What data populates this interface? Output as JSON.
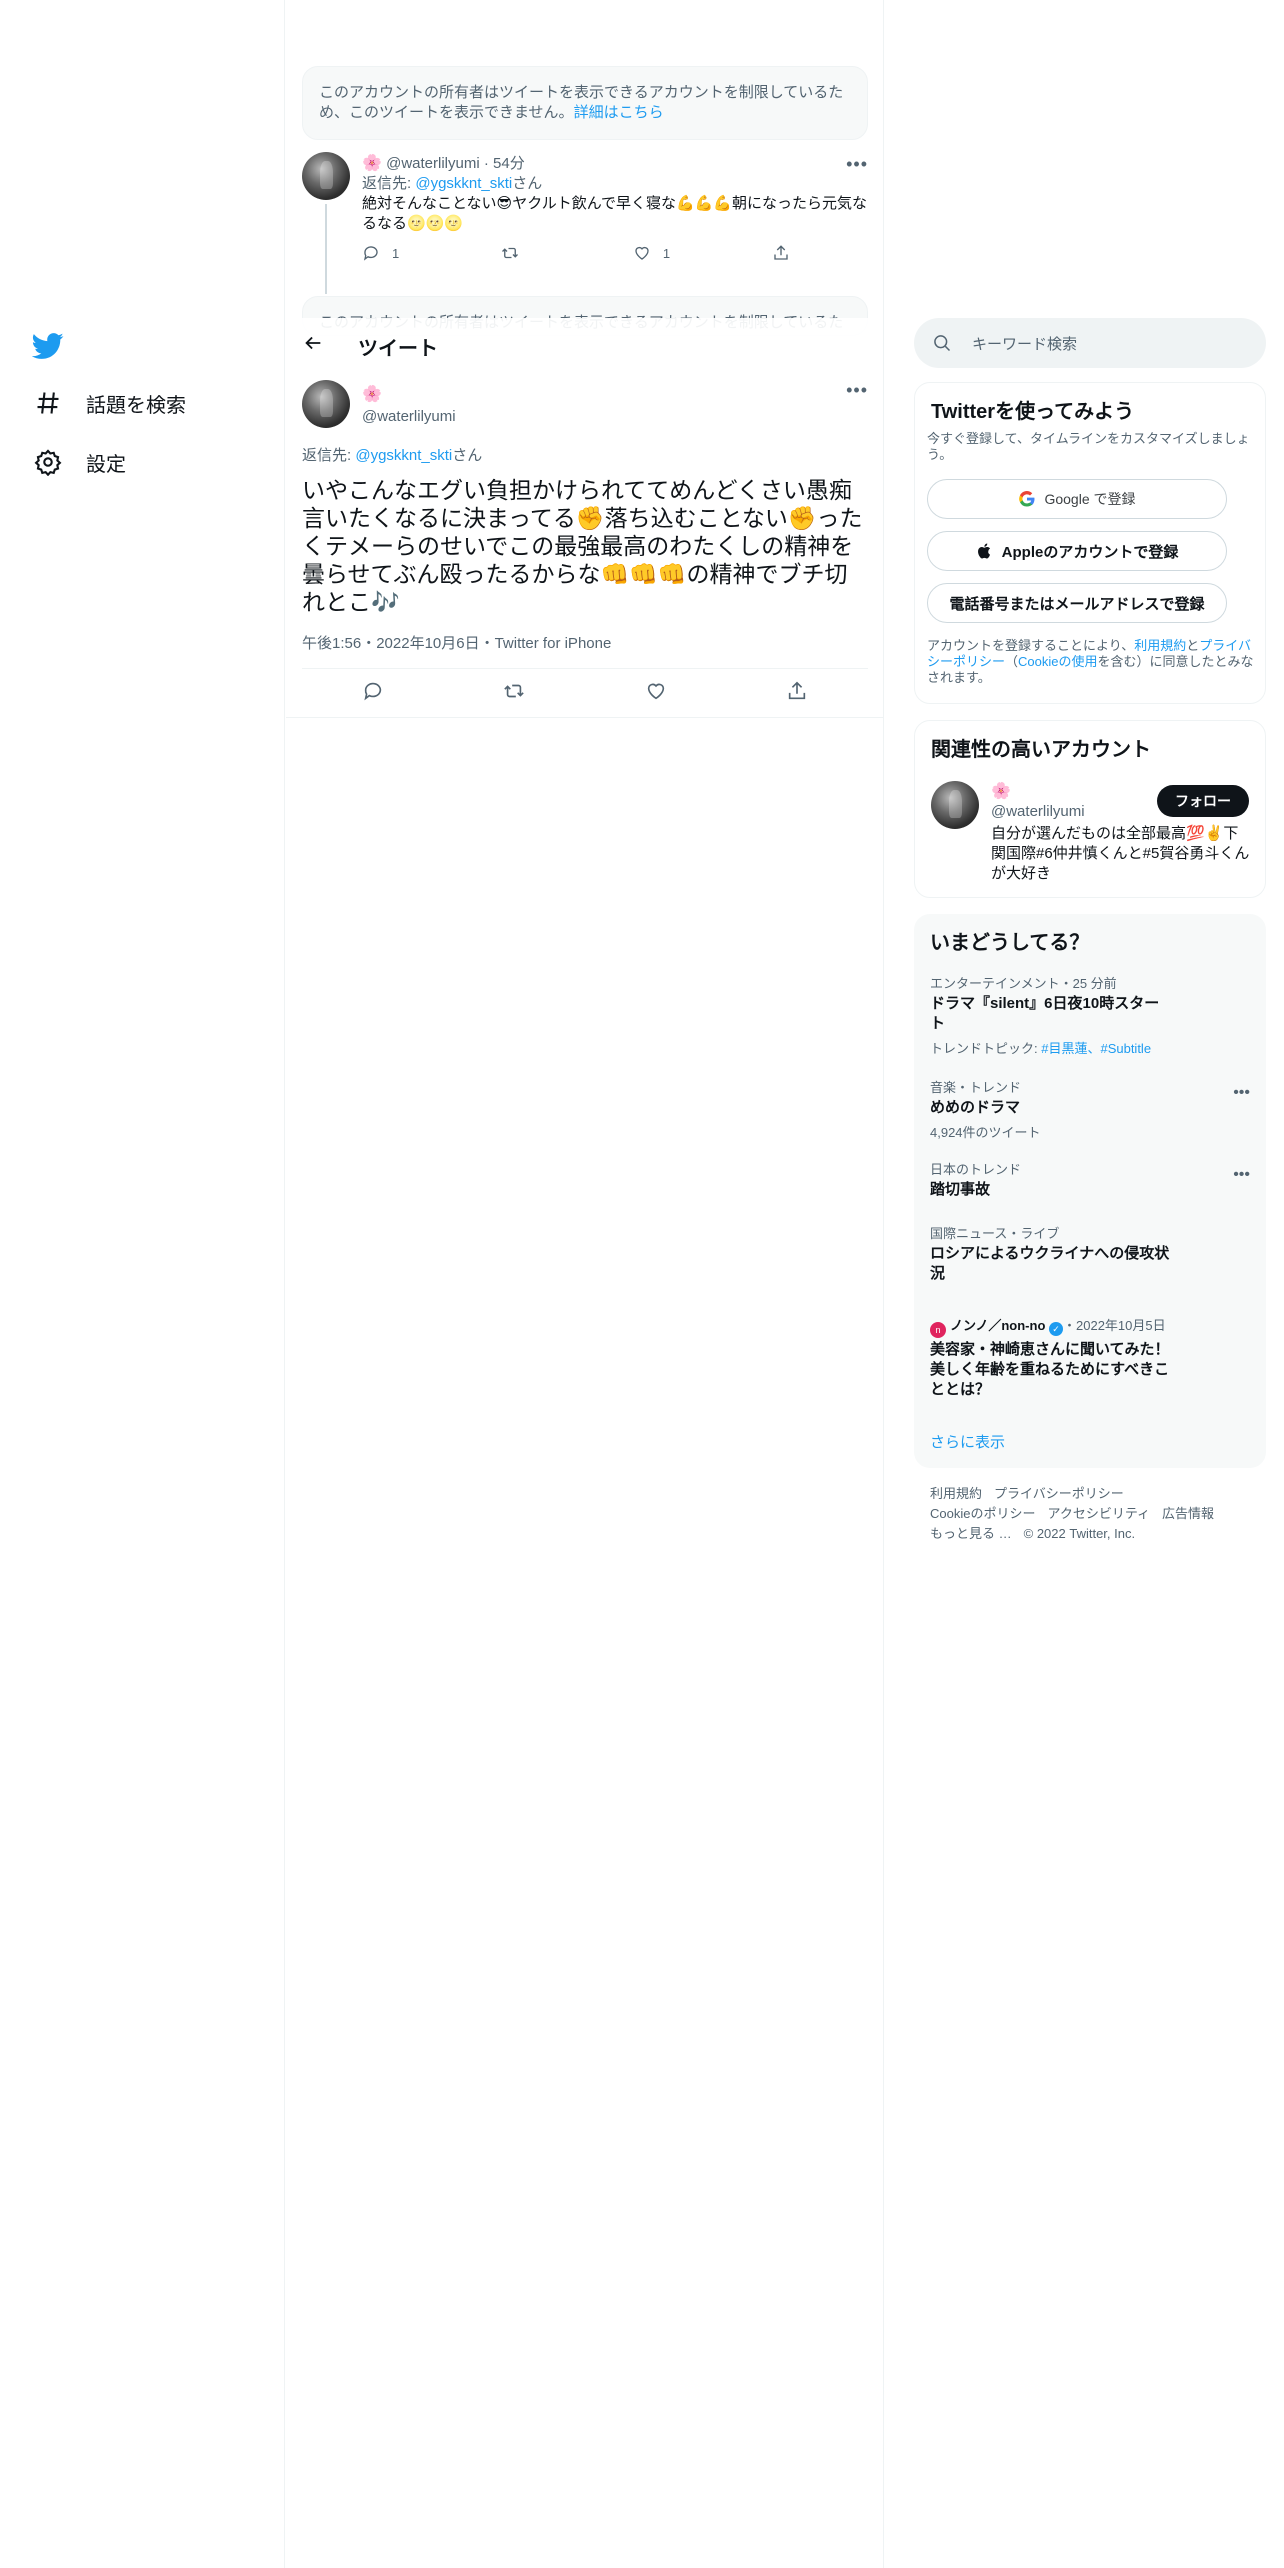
{
  "nav": {
    "explore_label": "話題を検索",
    "settings_label": "設定"
  },
  "notice": {
    "text": "このアカウントの所有者はツイートを表示できるアカウントを制限しているため、このツイートを表示できません。",
    "link": "詳細はこちら",
    "text_partial": "このアカウントの所有者はツイートを表示できるアカウントを制限しているた"
  },
  "prev_tweet": {
    "flower": "🌸",
    "handle": "@waterlilyumi",
    "time": "54分",
    "reply_prefix": "返信先: ",
    "reply_handle": "@ygskknt_skti",
    "reply_suffix": "さん",
    "text": "絶対そんなことない😎ヤクルト飲んで早く寝な💪💪💪朝になったら元気なるなる🌝🌝🌝",
    "reply_count": "1",
    "like_count": "1"
  },
  "header": {
    "title": "ツイート"
  },
  "main_tweet": {
    "flower": "🌸",
    "handle": "@waterlilyumi",
    "reply_prefix": "返信先: ",
    "reply_handle": "@ygskknt_skti",
    "reply_suffix": "さん",
    "text": "いやこんなエグい負担かけられててめんどくさい愚痴言いたくなるに決まってる✊落ち込むことない✊ったくテメーらのせいでこの最強最高のわたくしの精神を曇らせてぶん殴ったるからな👊👊👊の精神でブチ切れとこ🎶",
    "time": "午後1:56・2022年10月6日・Twitter for iPhone"
  },
  "search": {
    "placeholder": "キーワード検索"
  },
  "signup": {
    "title": "Twitterを使ってみよう",
    "subtitle": "今すぐ登録して、タイムラインをカスタマイズしましょう。",
    "google": "Google で登録",
    "apple": "Appleのアカウントで登録",
    "phone": "電話番号またはメールアドレスで登録",
    "legal_1": "アカウントを登録することにより、",
    "legal_terms": "利用規約",
    "legal_2": "と",
    "legal_privacy": "プライバシーポリシー",
    "legal_3": "（",
    "legal_cookie": "Cookieの使用",
    "legal_4": "を含む）に同意したとみなされます。"
  },
  "related": {
    "title": "関連性の高いアカウント",
    "flower": "🌸",
    "handle": "@waterlilyumi",
    "bio": "自分が選んだものは全部最高💯✌️下関国際#6仲井慎くんと#5賀谷勇斗くんが大好き",
    "follow": "フォロー"
  },
  "trends": {
    "title": "いまどうしてる？",
    "items": [
      {
        "context": "エンターテインメント・25 分前",
        "name": "ドラマ『silent』6日夜10時スタート",
        "extra_prefix": "トレンドトピック: ",
        "extra_tags": "#目黒蓮、#Subtitle"
      },
      {
        "context": "音楽・トレンド",
        "name": "めめのドラマ",
        "extra": "4,924件のツイート"
      },
      {
        "context": "日本のトレンド",
        "name": "踏切事故"
      },
      {
        "context": "国際ニュース・ライブ",
        "name": "ロシアによるウクライナへの侵攻状況"
      },
      {
        "context_source": "ノンノ／non-no",
        "context_date": "・2022年10月5日",
        "name": "美容家・神崎恵さんに聞いてみた！美しく年齢を重ねるためにすべきこととは？"
      }
    ],
    "show_more": "さらに表示"
  },
  "footer": {
    "links": [
      "利用規約",
      "プライバシーポリシー",
      "Cookieのポリシー",
      "アクセシビリティ",
      "広告情報",
      "もっと見る …",
      "© 2022 Twitter, Inc."
    ]
  },
  "colors": {
    "accent": "#1d9bf0",
    "text": "#0f1419",
    "muted": "#536471"
  }
}
